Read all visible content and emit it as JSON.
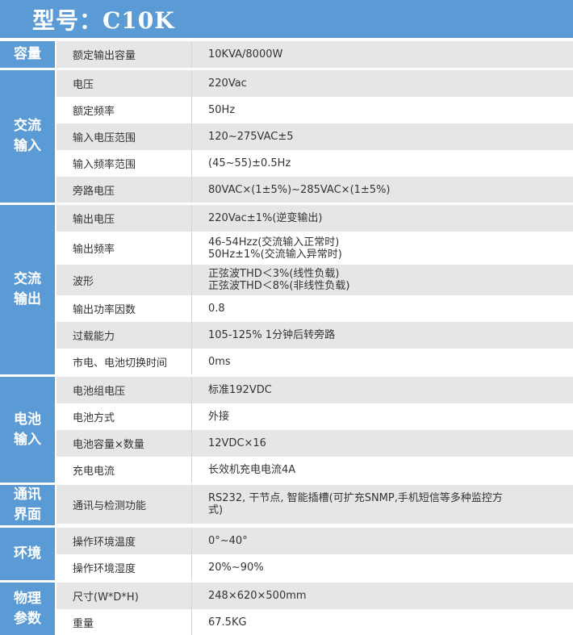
{
  "header": {
    "title": "型号：C10K"
  },
  "groups": [
    {
      "label": "容量",
      "rows": [
        {
          "name": "额定输出容量",
          "value": [
            "10KVA/8000W"
          ],
          "h": 33
        }
      ]
    },
    {
      "label": "交流输入",
      "rows": [
        {
          "name": "电压",
          "value": [
            "220Vac"
          ],
          "h": 33
        },
        {
          "name": "额定频率",
          "value": [
            "50Hz"
          ],
          "h": 33
        },
        {
          "name": "输入电压范围",
          "value": [
            "120~275VAC±5"
          ],
          "h": 33
        },
        {
          "name": "输入频率范围",
          "value": [
            "(45~55)±0.5Hz"
          ],
          "h": 33
        },
        {
          "name": "旁路电压",
          "value": [
            "80VAC×(1±5%)~285VAC×(1±5%)"
          ],
          "h": 32
        }
      ]
    },
    {
      "label": "交流输出",
      "rows": [
        {
          "name": "输出电压",
          "value": [
            "220Vac±1%(逆变输出)"
          ],
          "h": 33
        },
        {
          "name": "输出频率",
          "value": [
            "46-54Hzz(交流输入正常时)",
            "50Hz±1%(交流输入异常时)"
          ],
          "h": 41
        },
        {
          "name": "波形",
          "value": [
            "正弦波THD＜3%(线性负载)",
            "正弦波THD＜8%(非线性负载)"
          ],
          "h": 38
        },
        {
          "name": "输出功率因数",
          "value": [
            "0.8"
          ],
          "h": 33
        },
        {
          "name": "过载能力",
          "value": [
            "105-125% 1分钟后转旁路"
          ],
          "h": 33
        },
        {
          "name": "市电、电池切换时间",
          "value": [
            "0ms"
          ],
          "h": 32
        }
      ]
    },
    {
      "label": "电池输入",
      "rows": [
        {
          "name": "电池组电压",
          "value": [
            "标准192VDC"
          ],
          "h": 33
        },
        {
          "name": "电池方式",
          "value": [
            "外接"
          ],
          "h": 33
        },
        {
          "name": "电池容量×数量",
          "value": [
            "12VDC×16"
          ],
          "h": 33
        },
        {
          "name": "充电电流",
          "value": [
            "长效机充电电流4A"
          ],
          "h": 32
        }
      ]
    },
    {
      "label": "通讯界面",
      "rows": [
        {
          "name": "通讯与检测功能",
          "value": [
            "RS232, 干节点, 智能插槽(可扩充SNMP,手机短信等多种监控方",
            "式)"
          ],
          "h": 48
        }
      ]
    },
    {
      "label": "环境",
      "rows": [
        {
          "name": "操作环境温度",
          "value": [
            "0°~40°"
          ],
          "h": 33
        },
        {
          "name": "操作环境湿度",
          "value": [
            "20%~90%"
          ],
          "h": 32
        }
      ]
    },
    {
      "label": "物理参数",
      "rows": [
        {
          "name": "尺寸(W*D*H)",
          "value": [
            "248×620×500mm"
          ],
          "h": 33
        },
        {
          "name": "重量",
          "value": [
            "67.5KG"
          ],
          "h": 32
        }
      ]
    }
  ]
}
